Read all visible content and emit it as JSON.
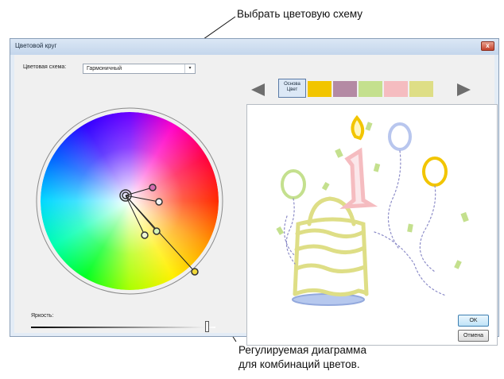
{
  "annotations": {
    "top": "Выбрать цветовую схему",
    "bottom_line1": "Регулируемая диаграмма",
    "bottom_line2": "для комбинаций цветов."
  },
  "dialog": {
    "title": "Цветовой круг",
    "close_glyph": "x",
    "scheme_label": "Цветовая схема:",
    "scheme_value": "Гармоничный",
    "scheme_arrow": "▾",
    "base_swatch_label_1": "Основа",
    "base_swatch_label_2": "Цвет",
    "swatch_colors": [
      "#f2c500",
      "#b48aa4",
      "#c4e08e",
      "#f5bcc0",
      "#dede86"
    ],
    "brightness_label": "Яркость:",
    "ok_label": "OK",
    "cancel_label": "Отмена",
    "accent_color": "#3c7fb1"
  }
}
